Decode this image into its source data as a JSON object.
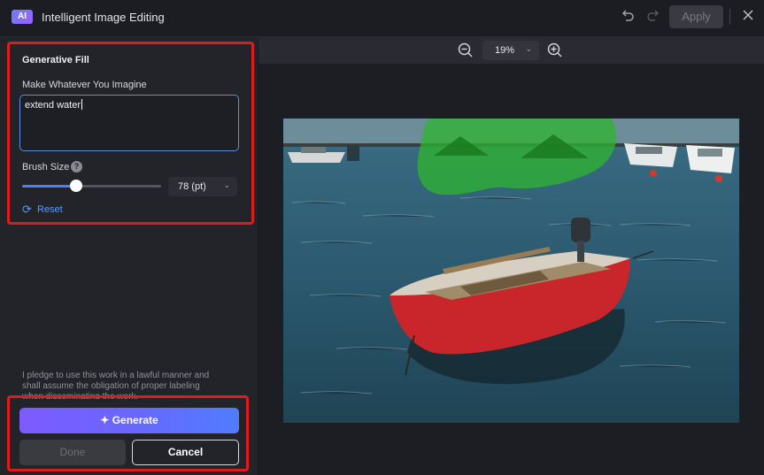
{
  "titlebar": {
    "logo": "AI",
    "title": "Intelligent Image Editing",
    "icons": [
      "undo-icon",
      "redo-icon",
      "close-icon"
    ],
    "apply_label": "Apply"
  },
  "zoom": {
    "value": "19%",
    "icons": [
      "zoom-out-icon",
      "chevron-down-icon",
      "zoom-in-icon"
    ]
  },
  "panel": {
    "heading": "Generative Fill",
    "prompt_label": "Make Whatever You Imagine",
    "prompt_value": "extend water",
    "brush_label": "Brush Size",
    "brush_value": "78 (pt)",
    "brush_level": 0.39,
    "reset_label": "Reset",
    "pledge_lines": [
      "I pledge to use this work in a lawful manner and",
      "shall assume the obligation of proper labeling",
      "when disseminating the work."
    ],
    "generate_label": "Generate",
    "done_label": "Done",
    "cancel_label": "Cancel"
  },
  "colors": {
    "accent": "#4b7fff",
    "highlight": "#e01b1b",
    "mask": "#2fb52f"
  }
}
